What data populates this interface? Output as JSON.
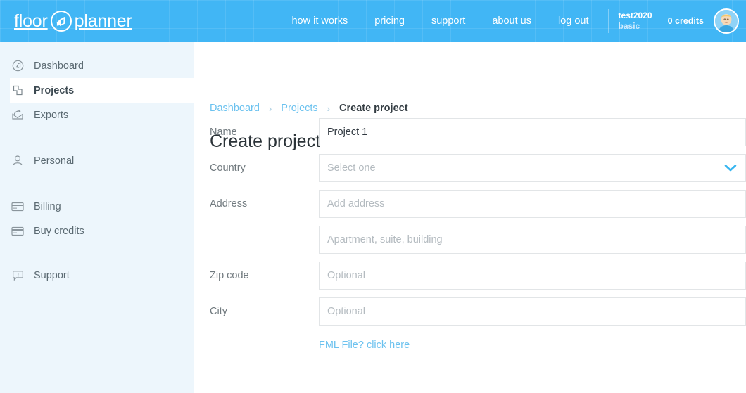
{
  "header": {
    "logo": {
      "word1": "floor",
      "word2": "planner",
      "mark_icon": "house-in-circle-icon"
    },
    "nav": [
      {
        "label": "how it works",
        "name": "nav-how-it-works"
      },
      {
        "label": "pricing",
        "name": "nav-pricing"
      },
      {
        "label": "support",
        "name": "nav-support"
      },
      {
        "label": "about us",
        "name": "nav-about-us"
      },
      {
        "label": "log out",
        "name": "nav-log-out"
      }
    ],
    "account": {
      "name": "test2020",
      "plan": "basic"
    },
    "credits": "0 credits",
    "avatar_icon": "user-avatar"
  },
  "sidebar": {
    "items": [
      {
        "label": "Dashboard",
        "icon": "dashboard-icon",
        "active": false
      },
      {
        "label": "Projects",
        "icon": "projects-icon",
        "active": true
      },
      {
        "label": "Exports",
        "icon": "exports-icon",
        "active": false
      },
      {
        "label": "Personal",
        "icon": "person-icon",
        "active": false
      },
      {
        "label": "Billing",
        "icon": "credit-card-icon",
        "active": false
      },
      {
        "label": "Buy credits",
        "icon": "credit-card-icon",
        "active": false
      },
      {
        "label": "Support",
        "icon": "support-bubble-icon",
        "active": false
      }
    ]
  },
  "breadcrumb": {
    "items": [
      "Dashboard",
      "Projects",
      "Create project"
    ],
    "separator": "›"
  },
  "page": {
    "title": "Create project"
  },
  "form": {
    "fields": [
      {
        "label": "Name",
        "value": "Project 1",
        "placeholder": "",
        "type": "text",
        "name": "name"
      },
      {
        "label": "Country",
        "value": "",
        "placeholder": "Select one",
        "type": "select",
        "name": "country"
      },
      {
        "label": "Address",
        "value": "",
        "placeholder": "Add address",
        "type": "text",
        "name": "address"
      },
      {
        "label": "",
        "value": "",
        "placeholder": "Apartment, suite, building",
        "type": "text",
        "name": "address2"
      },
      {
        "label": "Zip code",
        "value": "",
        "placeholder": "Optional",
        "type": "text",
        "name": "zip-code"
      },
      {
        "label": "City",
        "value": "",
        "placeholder": "Optional",
        "type": "text",
        "name": "city"
      }
    ],
    "fml_link": "FML File? click here"
  },
  "colors": {
    "header_blue": "#41b6f5",
    "sidebar_bg": "#edf6fc",
    "link_blue": "#6cc2ef",
    "chevron_blue": "#35b5f0",
    "label_gray": "#70797e",
    "placeholder_gray": "#b4bbc0",
    "border_gray": "#e2e5e7"
  }
}
